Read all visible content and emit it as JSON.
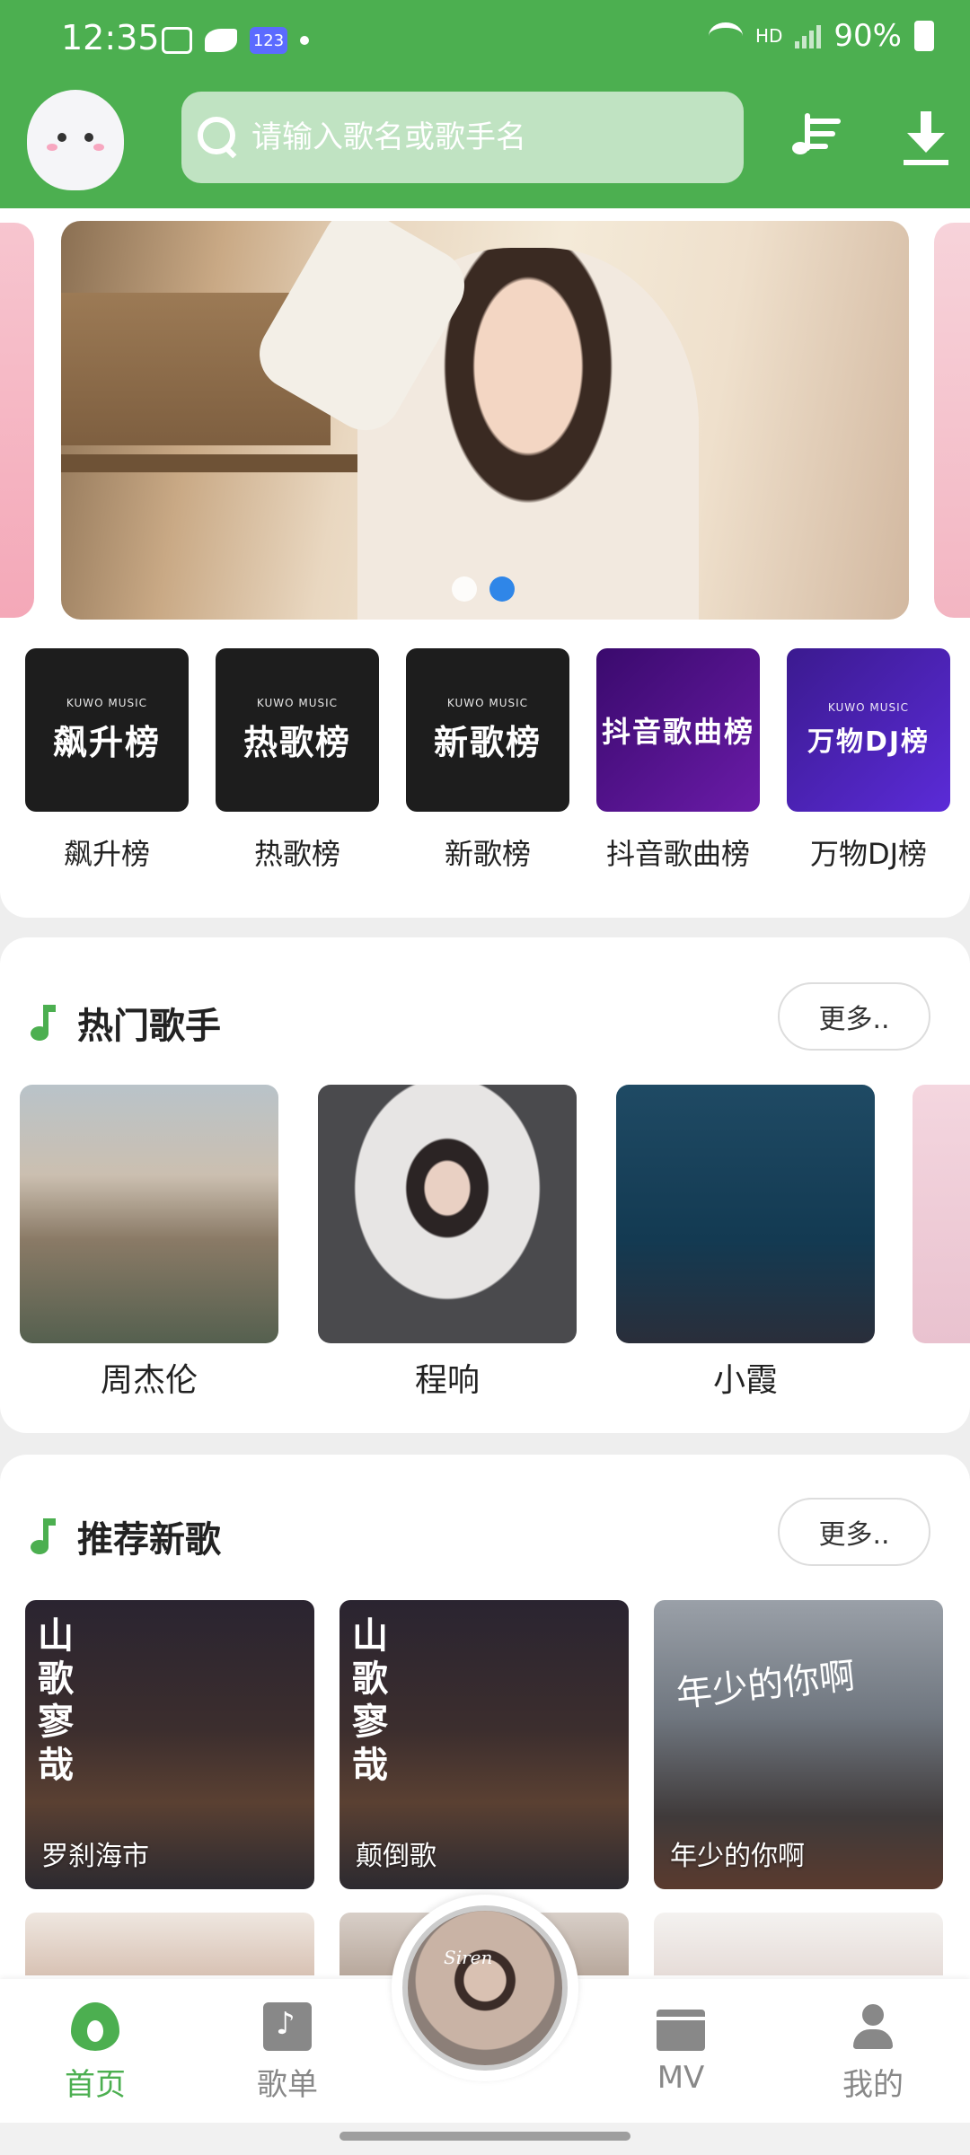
{
  "status_bar": {
    "time": "12:35",
    "battery": "90%",
    "network": "HD",
    "badge": "123"
  },
  "header": {
    "search_placeholder": "请输入歌名或歌手名"
  },
  "banner": {
    "dots_total": 2,
    "active_dot": 2
  },
  "charts": [
    {
      "brand": "KUWO MUSIC",
      "cover_text": "飙升榜",
      "label": "飙升榜"
    },
    {
      "brand": "KUWO MUSIC",
      "cover_text": "热歌榜",
      "label": "热歌榜"
    },
    {
      "brand": "KUWO MUSIC",
      "cover_text": "新歌榜",
      "label": "新歌榜"
    },
    {
      "brand": "",
      "cover_text": "抖音歌曲榜",
      "label": "抖音歌曲榜"
    },
    {
      "brand": "KUWO MUSIC",
      "cover_text": "万物DJ榜",
      "label": "万物DJ榜"
    }
  ],
  "hot_singers": {
    "title": "热门歌手",
    "more": "更多..",
    "items": [
      {
        "name": "周杰伦"
      },
      {
        "name": "程响"
      },
      {
        "name": "小霞"
      }
    ]
  },
  "new_songs": {
    "title": "推荐新歌",
    "more": "更多..",
    "items": [
      {
        "title": "罗刹海市",
        "art_text": "山歌寥哉"
      },
      {
        "title": "颠倒歌",
        "art_text": "山歌寥哉"
      },
      {
        "title": "年少的你啊",
        "art_text": "年少的你啊"
      }
    ]
  },
  "now_playing": {
    "disc_text": "Siren"
  },
  "bottom_nav": [
    {
      "label": "首页",
      "icon": "home-flame-icon",
      "active": true
    },
    {
      "label": "歌单",
      "icon": "songlist-icon",
      "active": false
    },
    {
      "label": "MV",
      "icon": "mv-clapper-icon",
      "active": false
    },
    {
      "label": "我的",
      "icon": "profile-icon",
      "active": false
    }
  ],
  "colors": {
    "brand_green": "#4caf50",
    "active_dot": "#2f86e8"
  }
}
